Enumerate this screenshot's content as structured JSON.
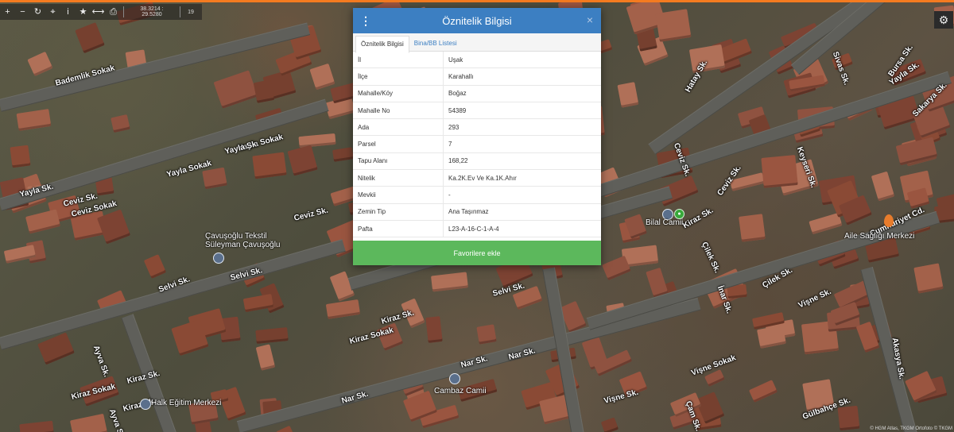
{
  "toolbar": {
    "tools": [
      {
        "icon": "zoom-in-icon",
        "glyph": "+"
      },
      {
        "icon": "zoom-out-icon",
        "glyph": "−"
      },
      {
        "icon": "refresh-icon",
        "glyph": "↻"
      },
      {
        "icon": "locate-icon",
        "glyph": "⌖"
      },
      {
        "icon": "info-icon",
        "glyph": "i"
      },
      {
        "icon": "favorite-star-icon",
        "glyph": "★"
      },
      {
        "icon": "measure-icon",
        "glyph": "⟷"
      },
      {
        "icon": "print-icon",
        "glyph": "⎙"
      }
    ],
    "coordinates": "38.3214 : 29.5280",
    "zoom_level": "19"
  },
  "settings": {
    "icon": "gear-icon",
    "glyph": "⚙"
  },
  "dialog": {
    "title": "Öznitelik Bilgisi",
    "menu_glyph": "⋮",
    "close_glyph": "×",
    "tabs": [
      {
        "label": "Öznitelik Bilgisi",
        "active": true
      },
      {
        "label": "Bina/BB Listesi",
        "active": false
      }
    ],
    "attributes": [
      {
        "key": "İl",
        "value": "Uşak"
      },
      {
        "key": "İlçe",
        "value": "Karahallı"
      },
      {
        "key": "Mahalle/Köy",
        "value": "Boğaz"
      },
      {
        "key": "Mahalle No",
        "value": "54389"
      },
      {
        "key": "Ada",
        "value": "293"
      },
      {
        "key": "Parsel",
        "value": "7"
      },
      {
        "key": "Tapu Alanı",
        "value": "168,22"
      },
      {
        "key": "Nitelik",
        "value": "Ka.2K.Ev Ve Ka.1K.Ahır"
      },
      {
        "key": "Mevkii",
        "value": "-"
      },
      {
        "key": "Zemin Tip",
        "value": "Ana Taşınmaz"
      },
      {
        "key": "Pafta",
        "value": "L23-A-16-C-1-A-4"
      }
    ],
    "favorite_button": "Favorilere ekle"
  },
  "map": {
    "streets": [
      "Bademlik Sokak",
      "Yayla Sokak",
      "Yayla Sk.",
      "Yayla Sokak",
      "Yayla Sk.",
      "Ceviz Sk.",
      "Ceviz Sokak",
      "Ceviz Sk.",
      "Selvi Sk.",
      "Selvi Sk.",
      "Selvi Sk.",
      "Kiraz Sk.",
      "Kiraz Sokak",
      "Kiraz Sk.",
      "Kiraz Sokak",
      "Kiraz Sk.",
      "Nar Sk.",
      "Nar Sk.",
      "Nar Sk.",
      "Ayva Sk.",
      "Ayva Sk.",
      "Hatay Sk.",
      "Ceviz Sk.",
      "Kiraz Sk.",
      "Çilek Sk.",
      "İnar Sk.",
      "Çilek Sk.",
      "Vişne Sk.",
      "Vişne Sokak",
      "Vişne Sk.",
      "Çam Sk.",
      "Cumhuriyet Cd.",
      "Akasya Sk.",
      "Ceviz Sk.",
      "Yayla Sk.",
      "Bursa Sk.",
      "Sivas Sk.",
      "Sakarya Sk.",
      "Keyseri Sk.",
      "Gülbahçe Sk.",
      "Kiraz Sk."
    ],
    "pois": [
      {
        "label": "Bilal Camii",
        "icon": "mosque-icon"
      },
      {
        "label": "Cambaz Camii",
        "icon": "mosque-icon"
      },
      {
        "label": "Çavuşoğlu Tekstil\nSüleyman Çavuşoğlu",
        "icon": "shop-icon"
      },
      {
        "label": "Halk Eğitim Merkezi",
        "icon": "school-icon"
      },
      {
        "label": "Aile Sağlığı Merkezi",
        "icon": "health-icon"
      }
    ],
    "attribution": "© HGM Atlas, TKGM Ortofoto © TKGM"
  }
}
